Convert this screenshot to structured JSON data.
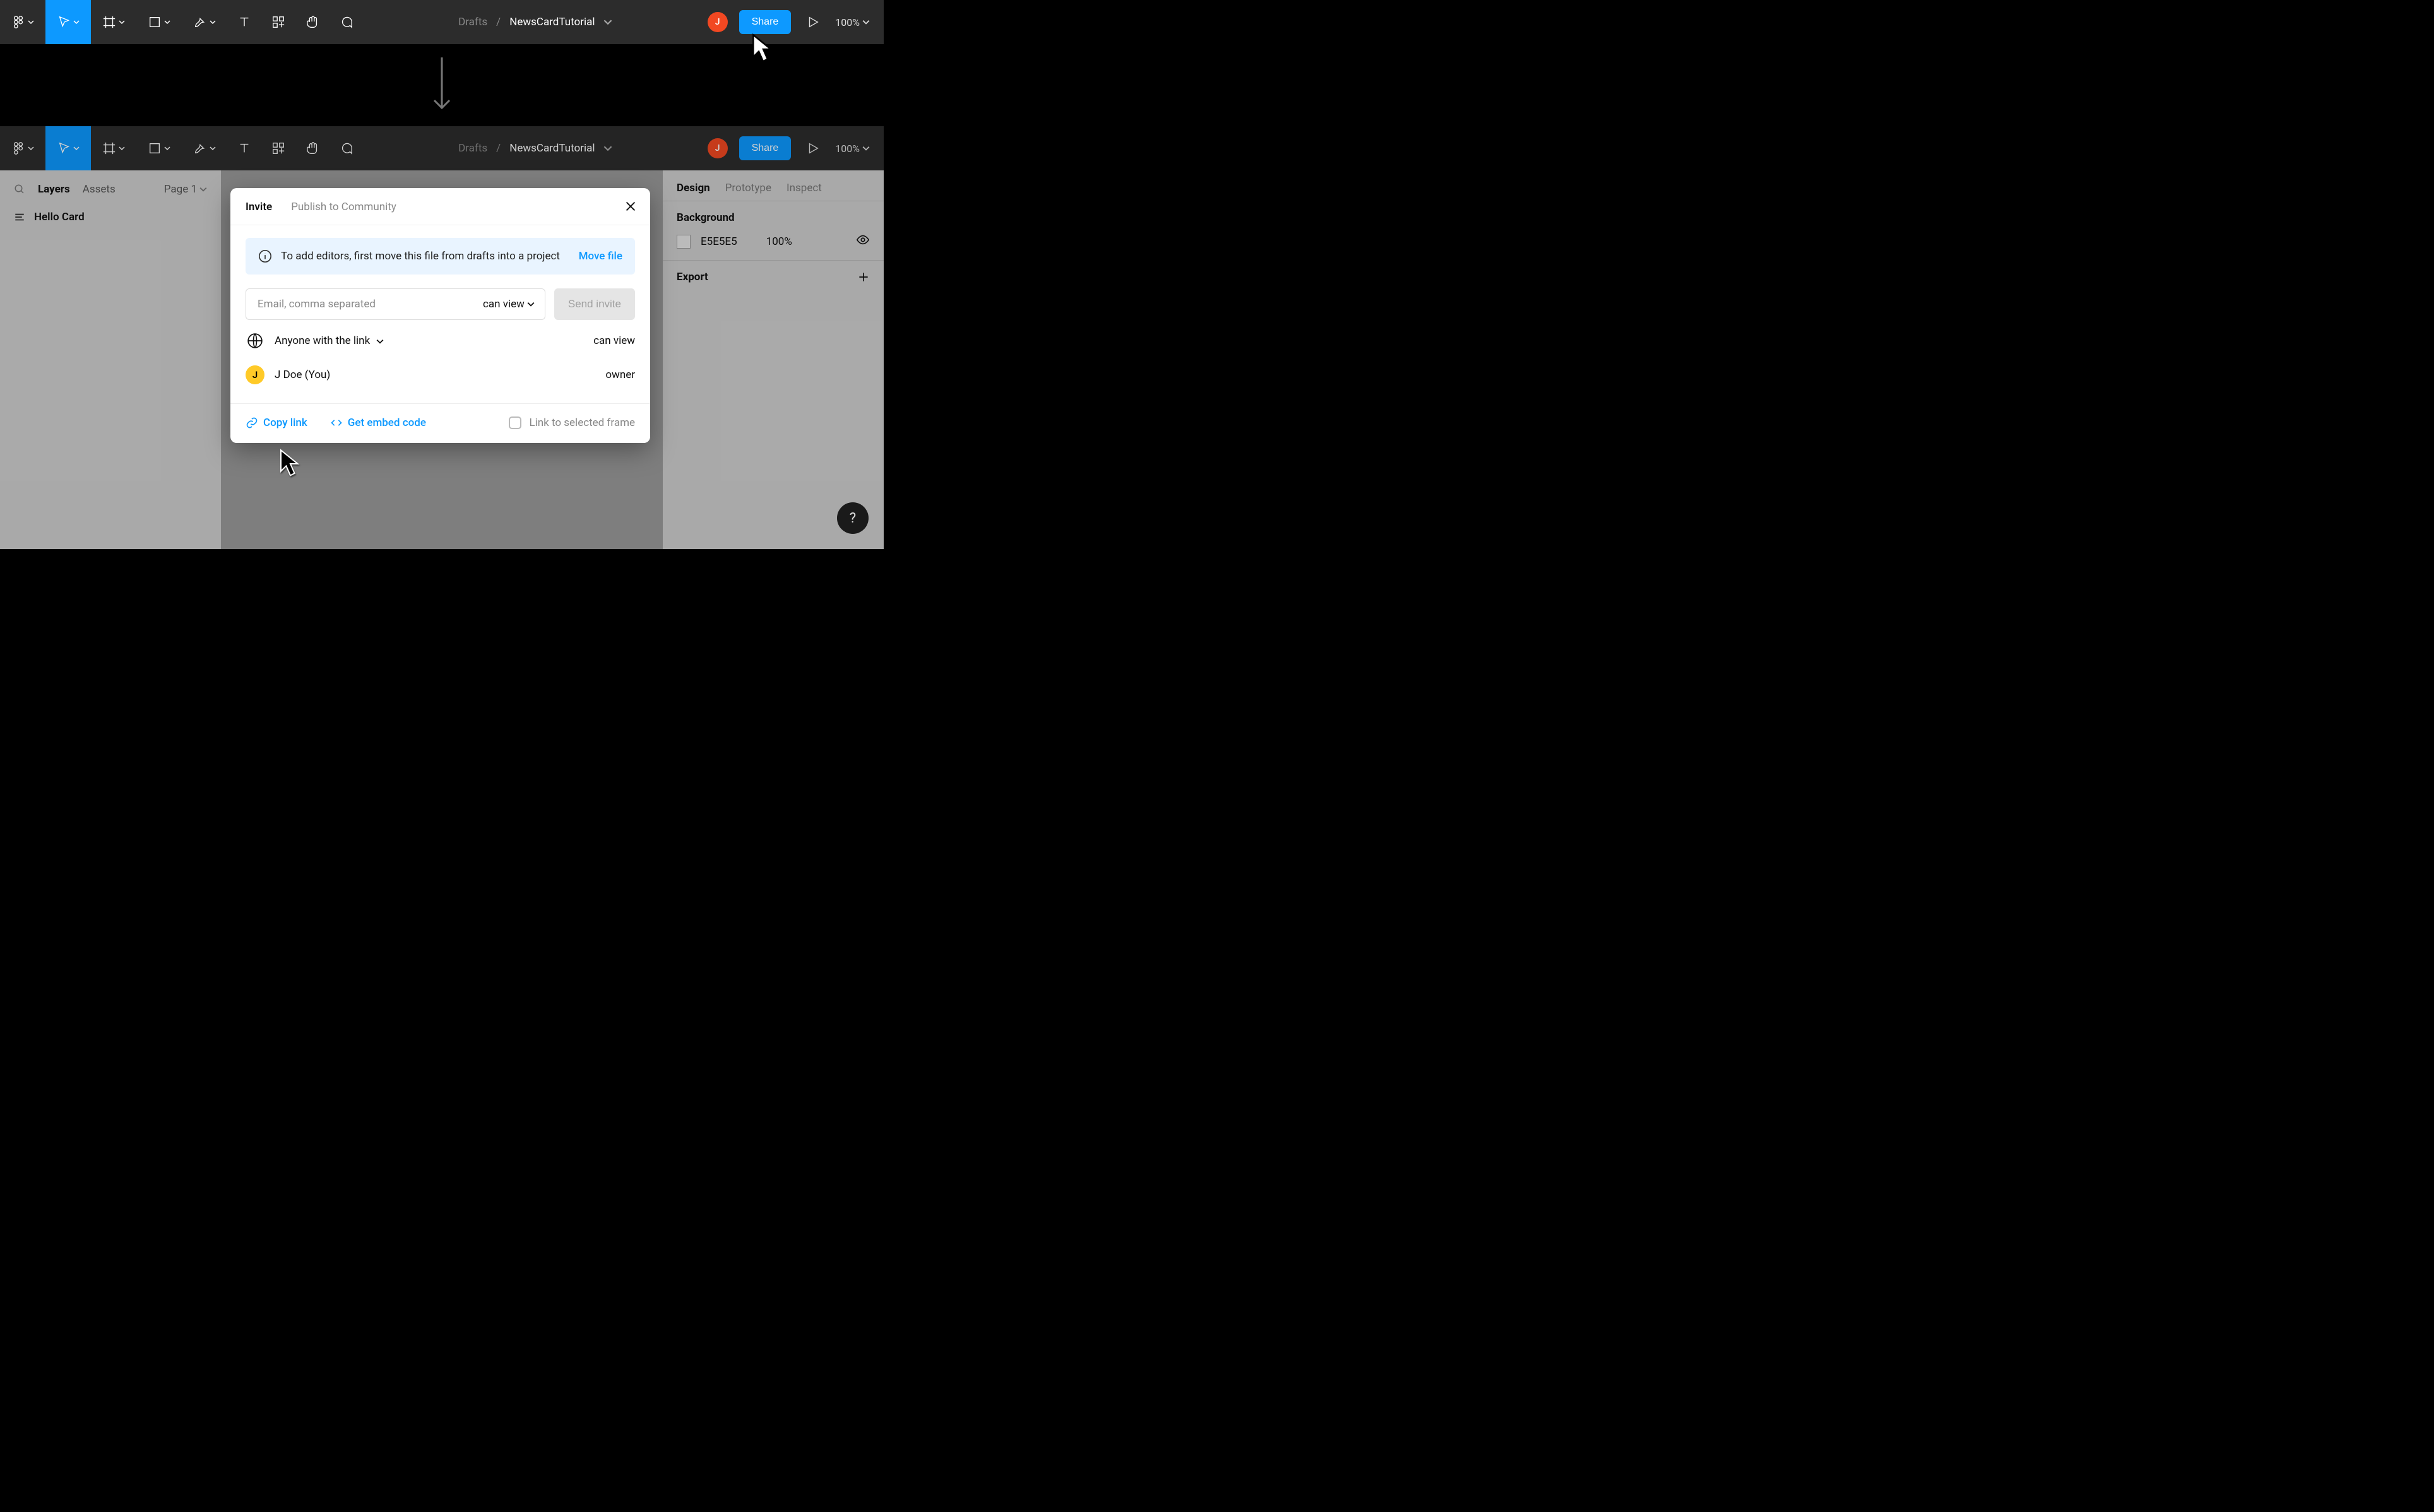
{
  "toolbar": {
    "crumbs": "Drafts",
    "separator": "/",
    "filename": "NewsCardTutorial",
    "avatar_initial": "J",
    "share_label": "Share",
    "zoom": "100%"
  },
  "left_panel": {
    "tab_layers": "Layers",
    "tab_assets": "Assets",
    "page_label": "Page 1",
    "layer_name": "Hello Card"
  },
  "right_panel": {
    "tab_design": "Design",
    "tab_prototype": "Prototype",
    "tab_inspect": "Inspect",
    "bg_label": "Background",
    "bg_color_hex": "E5E5E5",
    "bg_opacity": "100%",
    "export_label": "Export"
  },
  "modal": {
    "tab_invite": "Invite",
    "tab_publish": "Publish to Community",
    "banner_text": "To add editors, first move this file from drafts into a project",
    "banner_action": "Move file",
    "email_placeholder": "Email, comma separated",
    "email_perm": "can view",
    "send_label": "Send invite",
    "link_label": "Anyone with the link",
    "link_perm": "can view",
    "owner_name": "J Doe (You)",
    "owner_role": "owner",
    "owner_initial": "J",
    "copy_link": "Copy link",
    "embed": "Get embed code",
    "frame_link": "Link to selected frame"
  },
  "help_label": "?"
}
